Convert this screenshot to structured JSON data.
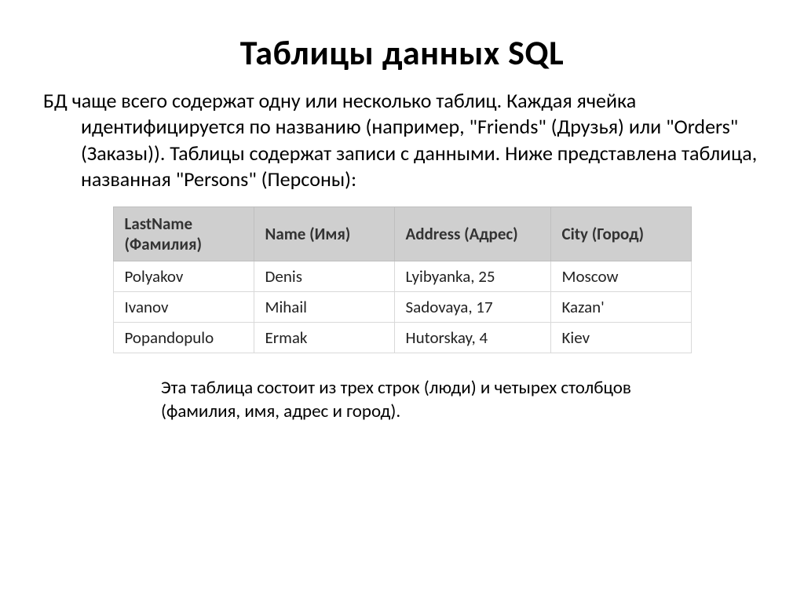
{
  "title": "Таблицы данных SQL",
  "paragraph": "БД чаще всего содержат одну или несколько таблиц. Каждая ячейка идентифицируется по названию (например, \"Friends\" (Друзья) или \"Orders\" (Заказы)). Таблицы содержат записи с данными. Ниже представлена таблица, названная \"Persons\" (Персоны):",
  "table": {
    "headers": {
      "lastname": "LastName (Фамилия)",
      "name": "Name (Имя)",
      "address": "Address (Адрес)",
      "city": "City (Город)"
    },
    "rows": [
      {
        "lastname": "Polyakov",
        "name": "Denis",
        "address": "Lyibyanka, 25",
        "city": "Moscow"
      },
      {
        "lastname": "Ivanov",
        "name": "Mihail",
        "address": "Sadovaya, 17",
        "city": "Kazan'"
      },
      {
        "lastname": "Popandopulo",
        "name": "Ermak",
        "address": "Hutorskay, 4",
        "city": "Kiev"
      }
    ]
  },
  "footnote": "Эта таблица состоит из трех строк (люди) и четырех столбцов (фамилия, имя, адрес и город)."
}
